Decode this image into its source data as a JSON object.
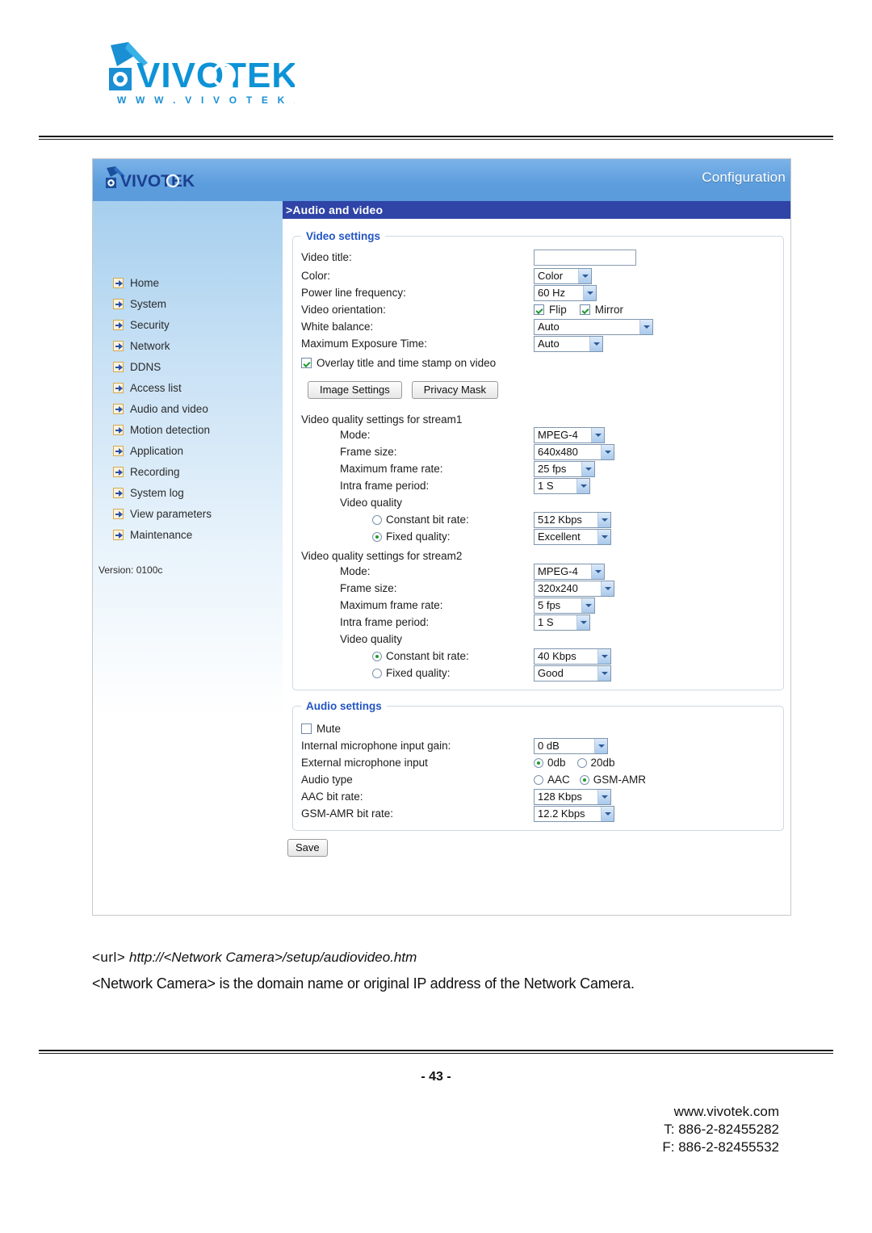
{
  "document": {
    "logo_alt": "VIVOTEK",
    "logo_tagline": "www.vivotek.com",
    "page_number": "- 43 -",
    "caption_url_prefix": "<url>",
    "caption_url": "http://<Network Camera>/setup/audiovideo.htm",
    "caption_note": "<Network Camera> is the domain name or original IP address of the Network Camera.",
    "footer": {
      "website": "www.vivotek.com",
      "tel": "T: 886-2-82455282",
      "fax": "F: 886-2-82455532"
    }
  },
  "app": {
    "header": {
      "brand": "VIVOTEK",
      "mode_label": "Configuration"
    },
    "page_title": ">Audio and video",
    "sidebar": {
      "items": [
        {
          "label": "Home"
        },
        {
          "label": "System"
        },
        {
          "label": "Security"
        },
        {
          "label": "Network"
        },
        {
          "label": "DDNS"
        },
        {
          "label": "Access list"
        },
        {
          "label": "Audio and video"
        },
        {
          "label": "Motion detection"
        },
        {
          "label": "Application"
        },
        {
          "label": "Recording"
        },
        {
          "label": "System log"
        },
        {
          "label": "View parameters"
        },
        {
          "label": "Maintenance"
        }
      ],
      "version": "Version: 0100c"
    },
    "video_settings": {
      "legend": "Video settings",
      "video_title_label": "Video title:",
      "video_title_value": "",
      "color_label": "Color:",
      "color_value": "Color",
      "power_line_label": "Power line frequency:",
      "power_line_value": "60 Hz",
      "orientation_label": "Video orientation:",
      "flip_label": "Flip",
      "flip_checked": true,
      "mirror_label": "Mirror",
      "mirror_checked": true,
      "white_balance_label": "White balance:",
      "white_balance_value": "Auto",
      "max_exposure_label": "Maximum Exposure Time:",
      "max_exposure_value": "Auto",
      "overlay_label": "Overlay title and time stamp on video",
      "overlay_checked": true,
      "image_settings_button": "Image Settings",
      "privacy_mask_button": "Privacy Mask",
      "stream1": {
        "caption": "Video quality settings for stream1",
        "mode_label": "Mode:",
        "mode_value": "MPEG-4",
        "frame_size_label": "Frame size:",
        "frame_size_value": "640x480",
        "max_frame_rate_label": "Maximum frame rate:",
        "max_frame_rate_value": "25 fps",
        "intra_label": "Intra frame period:",
        "intra_value": "1 S",
        "quality_label": "Video quality",
        "cbr_label": "Constant bit rate:",
        "cbr_value": "512 Kbps",
        "cbr_selected": false,
        "fixed_label": "Fixed quality:",
        "fixed_value": "Excellent",
        "fixed_selected": true
      },
      "stream2": {
        "caption": "Video quality settings for stream2",
        "mode_label": "Mode:",
        "mode_value": "MPEG-4",
        "frame_size_label": "Frame size:",
        "frame_size_value": "320x240",
        "max_frame_rate_label": "Maximum frame rate:",
        "max_frame_rate_value": "5 fps",
        "intra_label": "Intra frame period:",
        "intra_value": "1 S",
        "quality_label": "Video quality",
        "cbr_label": "Constant bit rate:",
        "cbr_value": "40 Kbps",
        "cbr_selected": true,
        "fixed_label": "Fixed quality:",
        "fixed_value": "Good",
        "fixed_selected": false
      }
    },
    "audio_settings": {
      "legend": "Audio settings",
      "mute_label": "Mute",
      "mute_checked": false,
      "internal_gain_label": "Internal microphone input gain:",
      "internal_gain_value": "0 dB",
      "external_input_label": "External microphone input",
      "external_0db_label": "0db",
      "external_0db_selected": true,
      "external_20db_label": "20db",
      "external_20db_selected": false,
      "audio_type_label": "Audio type",
      "aac_label": "AAC",
      "aac_selected": false,
      "gsm_label": "GSM-AMR",
      "gsm_selected": true,
      "aac_bitrate_label": "AAC bit rate:",
      "aac_bitrate_value": "128 Kbps",
      "gsm_bitrate_label": "GSM-AMR bit rate:",
      "gsm_bitrate_value": "12.2 Kbps"
    },
    "save_button": "Save"
  },
  "colors": {
    "header_blue": "#5c9ddd",
    "title_bar_blue": "#2f44a6",
    "legend_blue": "#2255c4",
    "sidebar_blue": "#a6cfee",
    "brand_blue": "#0d93d6",
    "check_green": "#1f9a2e"
  }
}
